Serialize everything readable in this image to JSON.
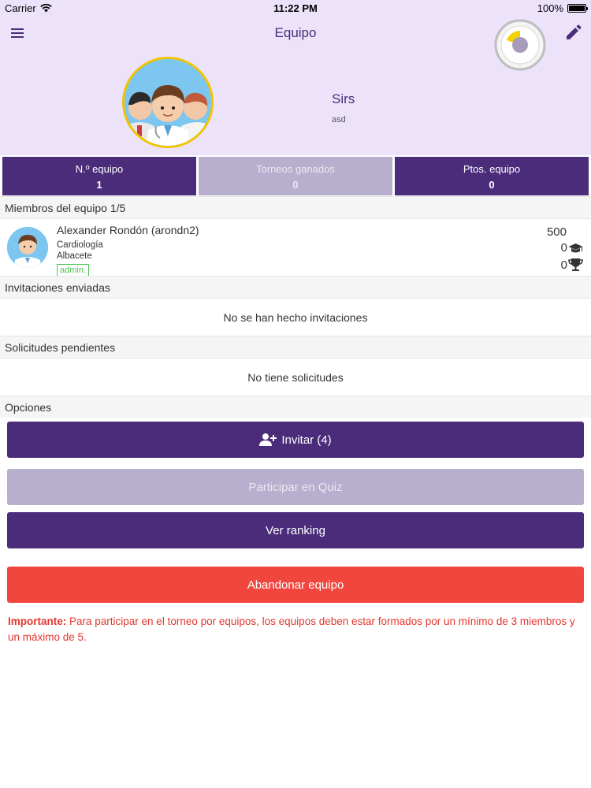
{
  "status_bar": {
    "carrier": "Carrier",
    "time": "11:22 PM",
    "battery": "100%"
  },
  "nav": {
    "title": "Equipo",
    "icons": {
      "menu": "hamburger-menu-icon",
      "edit": "pencil-icon",
      "timer": "timer-dial-icon"
    }
  },
  "team": {
    "name": "Sirs",
    "subtitle": "asd"
  },
  "stats": [
    {
      "label": "N.º equipo",
      "value": "1"
    },
    {
      "label": "Torneos ganados",
      "value": "0"
    },
    {
      "label": "Ptos. equipo",
      "value": "0"
    }
  ],
  "members": {
    "heading": "Miembros del equipo 1/5",
    "items": [
      {
        "name": "Alexander Rondón (arondn2)",
        "specialty": "Cardiología",
        "city": "Albacete",
        "role_badge": "admin.",
        "points": "500",
        "graduation_count": "0",
        "trophy_count": "0"
      }
    ]
  },
  "invitations": {
    "heading": "Invitaciones enviadas",
    "empty_text": "No se han hecho invitaciones"
  },
  "requests": {
    "heading": "Solicitudes pendientes",
    "empty_text": "No tiene solicitudes"
  },
  "options": {
    "heading": "Opciones",
    "invite_label": "Invitar (4)",
    "quiz_label": "Participar en Quiz",
    "ranking_label": "Ver ranking",
    "leave_label": "Abandonar equipo"
  },
  "notice": {
    "strong": "Importante:",
    "text": " Para participar en el torneo por equipos, los equipos deben estar formados por un mínimo de 3 miembros y un máximo de 5."
  },
  "colors": {
    "primary": "#4a2c7a",
    "disabled": "#b8aecd",
    "danger": "#f0463e",
    "header_bg": "#ece3fb",
    "badge_green": "#4fc24f",
    "timer_accent": "#f2d200"
  }
}
